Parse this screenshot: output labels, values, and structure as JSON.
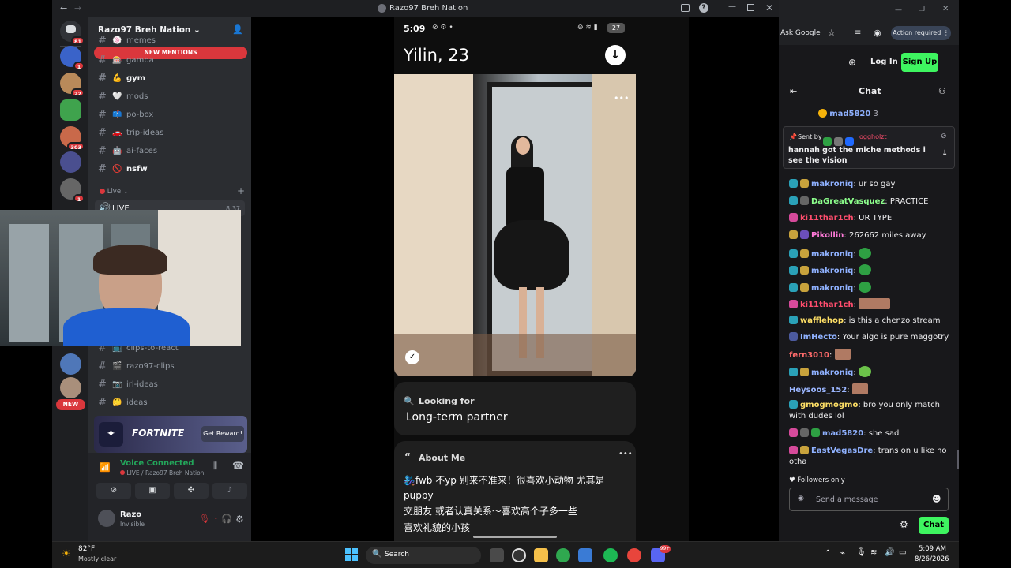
{
  "discord": {
    "window_title": "Razo97 Breh Nation",
    "server_name": "Razo97 Breh Nation",
    "new_mentions": "NEW MENTIONS",
    "server_badges": [
      "81",
      "1",
      "22",
      "303",
      "1",
      "NEW"
    ],
    "channels_top": [
      {
        "name": "memes",
        "emoji": "🍥",
        "unread": false
      },
      {
        "name": "gamba",
        "emoji": "🎰",
        "unread": false
      },
      {
        "name": "gym",
        "emoji": "💪",
        "unread": true
      },
      {
        "name": "mods",
        "emoji": "🤍",
        "unread": false
      },
      {
        "name": "po-box",
        "emoji": "📫",
        "unread": false
      },
      {
        "name": "trip-ideas",
        "emoji": "🚗",
        "unread": false
      },
      {
        "name": "ai-faces",
        "emoji": "🤖",
        "unread": false
      },
      {
        "name": "nsfw",
        "emoji": "🚫",
        "unread": true
      }
    ],
    "live_category": "Live",
    "live_channel": "LIVE",
    "live_time": "8:37",
    "channels_bottom": [
      {
        "name": "clips-to-react",
        "emoji": "📺"
      },
      {
        "name": "razo97-clips",
        "emoji": "🎬"
      },
      {
        "name": "irl-ideas",
        "emoji": "📷"
      },
      {
        "name": "ideas",
        "emoji": "🤔"
      }
    ],
    "promo_title": "FORTNITE",
    "promo_button": "Get Reward!",
    "voice_status": "Voice Connected",
    "voice_channel": "LIVE / Razo97 Breh Nation",
    "user_name": "Razo",
    "user_status": "Invisible"
  },
  "phone": {
    "time": "5:09",
    "battery": "27",
    "profile_name": "Yilin, 23",
    "looking_for_label": "Looking for",
    "looking_for_value": "Long-term partner",
    "about_title": "About Me",
    "about_text_1": "🧞‍♀️fwb  不yp 别来不准来！很喜欢小动物 尤其是puppy",
    "about_text_2": "交朋友 或者认真关系～喜欢高个子多一些",
    "about_text_3": "喜欢礼貌的小孩"
  },
  "browser": {
    "ask_google": "Ask Google",
    "action_required": "Action required"
  },
  "twitch": {
    "login": "Log In",
    "signup": "Sign Up",
    "chat_title": "Chat",
    "top_user": "mad5820",
    "top_count": "3",
    "pinned_label": "Sent by",
    "pinned_by": "oggholzt",
    "pinned_text": "hannah got the miche methods i see the vision",
    "messages": [
      {
        "user": "makroniq",
        "text": "ur so gay",
        "color": "#8fb1ff"
      },
      {
        "user": "DaGreatVasquez",
        "text": "PRACTICE",
        "color": "#8dff8c"
      },
      {
        "user": "ki11thar1ch",
        "text": "UR TYPE",
        "color": "#ff4d6d"
      },
      {
        "user": "Pikollin",
        "text": "262662 miles away",
        "color": "#ff7ad9"
      },
      {
        "user": "makroniq",
        "text": "",
        "color": "#8fb1ff"
      },
      {
        "user": "makroniq",
        "text": "",
        "color": "#8fb1ff"
      },
      {
        "user": "makroniq",
        "text": "",
        "color": "#8fb1ff"
      },
      {
        "user": "ki11thar1ch",
        "text": "",
        "color": "#ff4d6d"
      },
      {
        "user": "wafflehop",
        "text": "is this a chenzo stream",
        "color": "#ffe066"
      },
      {
        "user": "ImHecto",
        "text": "Your algo is pure maggotry",
        "color": "#8fb1ff"
      },
      {
        "user": "fern3010",
        "text": "",
        "color": "#ff6b6b"
      },
      {
        "user": "makroniq",
        "text": "",
        "color": "#8fb1ff"
      },
      {
        "user": "Heysoos_152",
        "text": "",
        "color": "#9bb6ff"
      },
      {
        "user": "gmogmogmo",
        "text": "bro you only match with dudes lol",
        "color": "#ffe066"
      },
      {
        "user": "mad5820",
        "text": "she sad",
        "color": "#8fb1ff"
      },
      {
        "user": "EastVegasDre",
        "text": "trans on u like no otha",
        "color": "#8fb1ff"
      }
    ],
    "badge_numbers": [
      "36",
      "33",
      "22",
      "97",
      "36",
      "36",
      "36",
      "22",
      "33",
      "36",
      "22",
      "28",
      "28"
    ],
    "followers_only": "Followers only",
    "send_placeholder": "Send a message",
    "chat_button": "Chat"
  },
  "taskbar": {
    "temperature": "82°F",
    "weather": "Mostly clear",
    "search": "Search",
    "time": "5:09 AM",
    "date": "8/26/2026",
    "notif_badge": "99+"
  },
  "colors": {
    "discord_bg": "#1e1f22",
    "channel_bg": "#2b2d31",
    "twitch_bg": "#18181b",
    "signup_green": "#3ef560",
    "mention_red": "#da373c"
  }
}
